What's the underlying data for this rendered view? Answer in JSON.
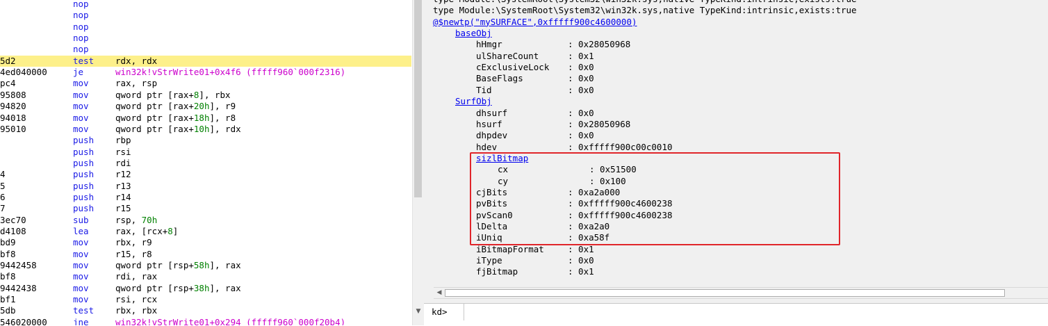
{
  "disasm": {
    "lines": [
      {
        "addr": "",
        "mn": "nop",
        "op": []
      },
      {
        "addr": "",
        "mn": "nop",
        "op": []
      },
      {
        "addr": "",
        "mn": "nop",
        "op": []
      },
      {
        "addr": "",
        "mn": "nop",
        "op": []
      },
      {
        "addr": "",
        "mn": "nop",
        "op": []
      },
      {
        "addr": "5d2",
        "mn": "test",
        "op": [
          {
            "t": "rdx, rdx"
          }
        ],
        "highlight": true
      },
      {
        "addr": "4ed040000",
        "mn": "je",
        "op": [
          {
            "t": "win32k!vStrWrite01+0x4f6 (fffff960`000f2316)",
            "c": "sym"
          }
        ]
      },
      {
        "addr": "pc4",
        "mn": "mov",
        "op": [
          {
            "t": "rax, rsp"
          }
        ]
      },
      {
        "addr": "95808",
        "mn": "mov",
        "op": [
          {
            "t": "qword ptr [rax+"
          },
          {
            "t": "8",
            "c": "num"
          },
          {
            "t": "], rbx"
          }
        ]
      },
      {
        "addr": "94820",
        "mn": "mov",
        "op": [
          {
            "t": "qword ptr [rax+"
          },
          {
            "t": "20h",
            "c": "num"
          },
          {
            "t": "], r9"
          }
        ]
      },
      {
        "addr": "94018",
        "mn": "mov",
        "op": [
          {
            "t": "qword ptr [rax+"
          },
          {
            "t": "18h",
            "c": "num"
          },
          {
            "t": "], r8"
          }
        ]
      },
      {
        "addr": "95010",
        "mn": "mov",
        "op": [
          {
            "t": "qword ptr [rax+"
          },
          {
            "t": "10h",
            "c": "num"
          },
          {
            "t": "], rdx"
          }
        ]
      },
      {
        "addr": "",
        "mn": "push",
        "op": [
          {
            "t": "rbp"
          }
        ]
      },
      {
        "addr": "",
        "mn": "push",
        "op": [
          {
            "t": "rsi"
          }
        ]
      },
      {
        "addr": "",
        "mn": "push",
        "op": [
          {
            "t": "rdi"
          }
        ]
      },
      {
        "addr": "4",
        "mn": "push",
        "op": [
          {
            "t": "r12"
          }
        ]
      },
      {
        "addr": "5",
        "mn": "push",
        "op": [
          {
            "t": "r13"
          }
        ]
      },
      {
        "addr": "6",
        "mn": "push",
        "op": [
          {
            "t": "r14"
          }
        ]
      },
      {
        "addr": "7",
        "mn": "push",
        "op": [
          {
            "t": "r15"
          }
        ]
      },
      {
        "addr": "3ec70",
        "mn": "sub",
        "op": [
          {
            "t": "rsp, "
          },
          {
            "t": "70h",
            "c": "num"
          }
        ]
      },
      {
        "addr": "d4108",
        "mn": "lea",
        "op": [
          {
            "t": "rax, [rcx+"
          },
          {
            "t": "8",
            "c": "num"
          },
          {
            "t": "]"
          }
        ]
      },
      {
        "addr": "bd9",
        "mn": "mov",
        "op": [
          {
            "t": "rbx, r9"
          }
        ]
      },
      {
        "addr": "bf8",
        "mn": "mov",
        "op": [
          {
            "t": "r15, r8"
          }
        ]
      },
      {
        "addr": "9442458",
        "mn": "mov",
        "op": [
          {
            "t": "qword ptr [rsp+"
          },
          {
            "t": "58h",
            "c": "num"
          },
          {
            "t": "], rax"
          }
        ]
      },
      {
        "addr": "bf8",
        "mn": "mov",
        "op": [
          {
            "t": "rdi, rax"
          }
        ]
      },
      {
        "addr": "9442438",
        "mn": "mov",
        "op": [
          {
            "t": "qword ptr [rsp+"
          },
          {
            "t": "38h",
            "c": "num"
          },
          {
            "t": "], rax"
          }
        ]
      },
      {
        "addr": "bf1",
        "mn": "mov",
        "op": [
          {
            "t": "rsi, rcx"
          }
        ]
      },
      {
        "addr": "5db",
        "mn": "test",
        "op": [
          {
            "t": "rbx, rbx"
          }
        ]
      },
      {
        "addr": "546020000",
        "mn": "jne",
        "op": [
          {
            "t": "win32k!vStrWrite01+0x294 (fffff960`000f20b4)",
            "c": "sym"
          }
        ]
      }
    ]
  },
  "output": {
    "top_line": "type Module:\\SystemRoot\\System32\\win32k.sys,native TypeKind:intrinsic,exists:true",
    "line1": "type Module:\\SystemRoot\\System32\\win32k.sys,native TypeKind:intrinsic,exists:true",
    "command_link": "@$newtp(\"mySURFACE\",0xfffff900c4600000)",
    "sections": [
      {
        "label": "baseObj",
        "fields": [
          {
            "k": "hHmgr",
            "v": ": 0x28050968"
          },
          {
            "k": "ulShareCount",
            "v": ": 0x1"
          },
          {
            "k": "cExclusiveLock",
            "v": ": 0x0"
          },
          {
            "k": "BaseFlags",
            "v": ": 0x0"
          },
          {
            "k": "Tid",
            "v": ": 0x0"
          }
        ]
      },
      {
        "label": "SurfObj",
        "fields": [
          {
            "k": "dhsurf",
            "v": ": 0x0"
          },
          {
            "k": "hsurf",
            "v": ": 0x28050968"
          },
          {
            "k": "dhpdev",
            "v": ": 0x0"
          },
          {
            "k": "hdev",
            "v": ": 0xfffff900c00c0010"
          }
        ]
      }
    ],
    "sizl": {
      "label": "sizlBitmap",
      "cx": ": 0x51500",
      "cy": ": 0x100"
    },
    "more_fields": [
      {
        "k": "cjBits",
        "v": ": 0xa2a000"
      },
      {
        "k": "pvBits",
        "v": ": 0xfffff900c4600238"
      },
      {
        "k": "pvScan0",
        "v": ": 0xfffff900c4600238"
      },
      {
        "k": "lDelta",
        "v": ": 0xa2a0"
      },
      {
        "k": "iUniq",
        "v": ": 0xa58f"
      },
      {
        "k": "iBitmapFormat",
        "v": ": 0x1"
      },
      {
        "k": "iType",
        "v": ": 0x0"
      },
      {
        "k": "fjBitmap",
        "v": ": 0x1"
      }
    ]
  },
  "command": {
    "prompt": "kd>",
    "value": ""
  },
  "colors": {
    "highlight": "#fdf08a",
    "mnemonic": "#1a1ae6",
    "number": "#008000",
    "symbol": "#cc00cc",
    "link": "#0000ee",
    "annotation_box": "#e0252a"
  }
}
